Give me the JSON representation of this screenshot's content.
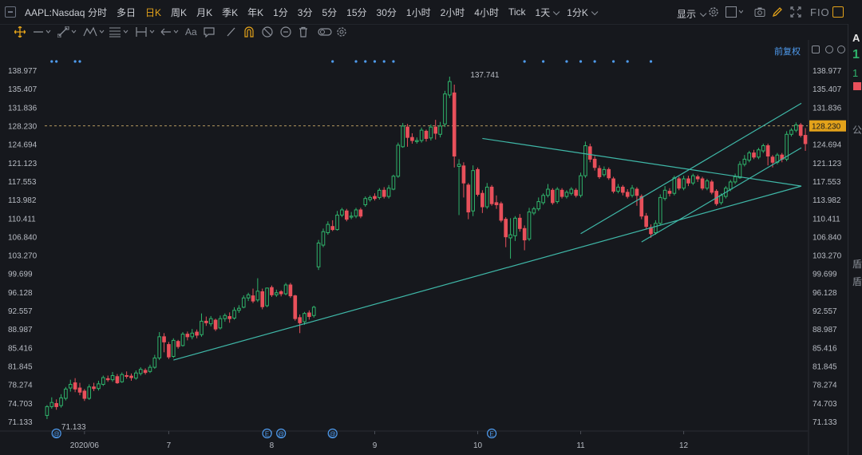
{
  "toolbar": {
    "symbol": "AAPL:Nasdaq",
    "periods": [
      {
        "label": "分时",
        "active": false
      },
      {
        "label": "多日",
        "active": false
      },
      {
        "label": "日K",
        "active": true
      },
      {
        "label": "周K",
        "active": false
      },
      {
        "label": "月K",
        "active": false
      },
      {
        "label": "季K",
        "active": false
      },
      {
        "label": "年K",
        "active": false
      },
      {
        "label": "1分",
        "active": false
      },
      {
        "label": "3分",
        "active": false
      },
      {
        "label": "5分",
        "active": false
      },
      {
        "label": "15分",
        "active": false
      },
      {
        "label": "30分",
        "active": false
      },
      {
        "label": "1小时",
        "active": false
      },
      {
        "label": "2小时",
        "active": false
      },
      {
        "label": "4小时",
        "active": false
      },
      {
        "label": "Tick",
        "active": false
      },
      {
        "label": "1天",
        "active": false
      },
      {
        "label": "1分K",
        "active": false
      }
    ],
    "display_label": "显示",
    "fio_label": "FIO",
    "text_tool_label": "Aa"
  },
  "adjust_label": "前复权",
  "side_panel": {
    "letters": [
      "A",
      "1",
      "1",
      "公",
      "盾",
      "盾"
    ]
  },
  "colors": {
    "up": "#2fb36b",
    "down": "#e8505b",
    "trend": "#3fb8a8",
    "accent": "#e3a21a",
    "link": "#4f9cf0"
  },
  "chart_data": {
    "type": "candlestick",
    "y_ticks": [
      "138.977",
      "135.407",
      "131.836",
      "128.230",
      "124.694",
      "121.123",
      "117.553",
      "113.982",
      "110.411",
      "106.840",
      "103.270",
      "99.699",
      "96.128",
      "92.557",
      "88.987",
      "85.416",
      "81.845",
      "78.274",
      "74.703",
      "71.133"
    ],
    "x_ticks": [
      "2020/06",
      "7",
      "8",
      "9",
      "10",
      "11",
      "12"
    ],
    "current_price": "128.230",
    "high_label": "137.741",
    "low_label": "71.133",
    "ylim": [
      71.133,
      138.977
    ],
    "event_markers": [
      "@",
      "E",
      "@",
      "@",
      "E"
    ],
    "candles": [
      [
        72.3,
        74.0,
        71.6,
        74.3
      ],
      [
        74.0,
        74.8,
        73.6,
        75.8
      ],
      [
        74.6,
        74.0,
        73.4,
        75.4
      ],
      [
        74.2,
        75.7,
        73.8,
        76.4
      ],
      [
        75.6,
        77.4,
        75.2,
        77.8
      ],
      [
        77.6,
        78.3,
        76.9,
        79.2
      ],
      [
        78.6,
        77.4,
        76.8,
        79.5
      ],
      [
        77.6,
        76.8,
        76.2,
        78.6
      ],
      [
        77.0,
        75.6,
        75.1,
        77.4
      ],
      [
        75.6,
        77.8,
        75.3,
        78.3
      ],
      [
        77.8,
        77.5,
        77.0,
        78.6
      ],
      [
        77.5,
        78.4,
        77.1,
        79.0
      ],
      [
        78.3,
        79.6,
        78.0,
        80.0
      ],
      [
        79.4,
        79.2,
        78.8,
        80.0
      ],
      [
        79.2,
        80.0,
        78.8,
        80.7
      ],
      [
        79.8,
        78.6,
        78.4,
        80.3
      ],
      [
        78.8,
        80.2,
        78.6,
        80.6
      ],
      [
        80.0,
        79.9,
        79.4,
        80.8
      ],
      [
        79.9,
        79.6,
        79.0,
        80.4
      ],
      [
        79.5,
        80.5,
        79.2,
        81.0
      ],
      [
        80.4,
        81.2,
        80.0,
        81.6
      ],
      [
        81.0,
        80.6,
        80.2,
        81.4
      ],
      [
        80.8,
        81.6,
        80.5,
        82.1
      ],
      [
        81.6,
        83.4,
        81.3,
        84.0
      ],
      [
        83.4,
        87.5,
        83.0,
        88.4
      ],
      [
        87.5,
        86.5,
        84.5,
        88.2
      ],
      [
        86.0,
        83.6,
        83.2,
        86.5
      ],
      [
        83.7,
        86.8,
        83.4,
        87.2
      ],
      [
        86.6,
        85.6,
        85.2,
        86.9
      ],
      [
        85.8,
        88.0,
        85.6,
        88.4
      ],
      [
        88.0,
        87.5,
        86.8,
        88.5
      ],
      [
        87.5,
        88.2,
        87.0,
        89.0
      ],
      [
        88.4,
        87.8,
        87.2,
        88.9
      ],
      [
        87.9,
        90.5,
        87.5,
        92.0
      ],
      [
        90.5,
        90.2,
        89.6,
        91.4
      ],
      [
        90.0,
        91.0,
        89.5,
        91.5
      ],
      [
        90.7,
        89.0,
        88.6,
        91.0
      ],
      [
        89.2,
        91.0,
        88.9,
        91.6
      ],
      [
        91.0,
        91.6,
        90.4,
        92.0
      ],
      [
        91.4,
        91.0,
        90.2,
        92.2
      ],
      [
        91.1,
        92.6,
        90.8,
        93.2
      ],
      [
        92.6,
        93.0,
        92.1,
        93.6
      ],
      [
        93.2,
        95.0,
        93.0,
        95.5
      ],
      [
        95.0,
        95.6,
        94.4,
        96.0
      ],
      [
        95.4,
        94.4,
        94.0,
        96.8
      ],
      [
        94.6,
        96.3,
        94.2,
        98.8
      ],
      [
        96.2,
        93.3,
        92.8,
        96.8
      ],
      [
        93.5,
        96.9,
        93.2,
        97.0
      ],
      [
        97.0,
        95.6,
        95.2,
        97.4
      ],
      [
        95.6,
        96.0,
        95.2,
        96.6
      ],
      [
        96.2,
        95.8,
        95.3,
        96.5
      ],
      [
        95.8,
        97.5,
        95.5,
        97.9
      ],
      [
        97.5,
        95.4,
        95.0,
        97.9
      ],
      [
        95.4,
        91.0,
        90.6,
        95.6
      ],
      [
        91.2,
        90.2,
        88.2,
        91.8
      ],
      [
        90.4,
        92.0,
        89.8,
        92.3
      ],
      [
        92.1,
        91.4,
        90.8,
        92.6
      ],
      [
        91.6,
        93.2,
        91.2,
        93.5
      ],
      [
        101.0,
        105.6,
        100.4,
        106.2
      ],
      [
        105.2,
        107.8,
        104.8,
        108.4
      ],
      [
        107.6,
        109.2,
        107.2,
        109.8
      ],
      [
        108.8,
        108.2,
        107.9,
        110.0
      ],
      [
        108.2,
        111.0,
        108.0,
        111.8
      ],
      [
        111.0,
        112.0,
        110.6,
        112.4
      ],
      [
        111.8,
        110.2,
        109.8,
        112.2
      ],
      [
        110.6,
        110.8,
        110.2,
        111.6
      ],
      [
        110.8,
        112.0,
        110.4,
        112.4
      ],
      [
        112.0,
        110.8,
        110.4,
        112.4
      ],
      [
        113.0,
        114.2,
        112.6,
        114.6
      ],
      [
        114.0,
        114.4,
        113.6,
        114.8
      ],
      [
        114.6,
        114.2,
        113.8,
        115.2
      ],
      [
        114.4,
        115.8,
        114.0,
        116.2
      ],
      [
        115.8,
        114.6,
        114.2,
        116.4
      ],
      [
        114.6,
        116.2,
        114.2,
        116.8
      ],
      [
        116.0,
        118.5,
        115.8,
        118.8
      ],
      [
        118.5,
        124.5,
        118.2,
        125.0
      ],
      [
        124.2,
        128.2,
        124.0,
        128.8
      ],
      [
        128.0,
        126.0,
        124.2,
        128.6
      ],
      [
        126.0,
        125.4,
        124.8,
        126.8
      ],
      [
        125.2,
        125.4,
        124.8,
        126.0
      ],
      [
        125.4,
        127.4,
        125.0,
        127.9
      ],
      [
        127.2,
        125.8,
        125.2,
        127.5
      ],
      [
        125.9,
        128.0,
        125.4,
        128.5
      ],
      [
        128.0,
        126.8,
        125.6,
        129.4
      ],
      [
        126.6,
        128.2,
        126.0,
        129.0
      ],
      [
        128.6,
        134.4,
        128.0,
        135.0
      ],
      [
        134.2,
        136.8,
        133.6,
        137.741
      ],
      [
        134.6,
        122.4,
        120.2,
        136.2
      ],
      [
        120.4,
        120.8,
        111.0,
        121.8
      ],
      [
        120.5,
        117.2,
        114.4,
        121.2
      ],
      [
        116.8,
        111.6,
        110.2,
        117.2
      ],
      [
        111.8,
        119.6,
        110.8,
        120.6
      ],
      [
        119.8,
        115.0,
        114.6,
        120.2
      ],
      [
        115.2,
        112.6,
        111.4,
        115.8
      ],
      [
        112.6,
        116.4,
        112.2,
        117.2
      ],
      [
        116.4,
        113.2,
        112.8,
        116.8
      ],
      [
        113.4,
        113.0,
        112.2,
        114.8
      ],
      [
        113.2,
        110.0,
        109.6,
        113.6
      ],
      [
        110.2,
        106.8,
        104.8,
        110.6
      ],
      [
        106.6,
        107.2,
        102.6,
        110.4
      ],
      [
        107.0,
        110.4,
        106.0,
        110.8
      ],
      [
        110.4,
        108.4,
        107.8,
        111.2
      ],
      [
        108.4,
        106.2,
        104.2,
        109.0
      ],
      [
        106.4,
        111.6,
        106.0,
        112.4
      ],
      [
        111.4,
        112.2,
        111.0,
        112.6
      ],
      [
        112.2,
        113.6,
        111.8,
        114.4
      ],
      [
        113.4,
        114.8,
        113.0,
        115.2
      ],
      [
        114.8,
        116.0,
        114.4,
        117.0
      ],
      [
        115.8,
        113.4,
        113.0,
        116.2
      ],
      [
        113.6,
        116.0,
        113.2,
        116.4
      ],
      [
        115.8,
        114.6,
        114.2,
        116.2
      ],
      [
        114.6,
        115.4,
        114.2,
        115.8
      ],
      [
        115.2,
        116.0,
        114.8,
        116.4
      ],
      [
        115.8,
        114.8,
        114.4,
        116.2
      ],
      [
        114.8,
        118.6,
        114.4,
        119.2
      ],
      [
        118.6,
        124.4,
        118.2,
        125.2
      ],
      [
        124.2,
        121.8,
        121.2,
        124.8
      ],
      [
        121.8,
        120.2,
        119.6,
        122.4
      ],
      [
        120.0,
        118.4,
        118.0,
        120.6
      ],
      [
        118.8,
        119.8,
        118.4,
        120.4
      ],
      [
        119.8,
        118.2,
        117.8,
        120.2
      ],
      [
        118.0,
        115.6,
        115.2,
        118.4
      ],
      [
        115.6,
        116.4,
        115.2,
        117.0
      ],
      [
        116.4,
        115.4,
        114.8,
        116.8
      ],
      [
        115.4,
        114.6,
        114.2,
        116.0
      ],
      [
        114.8,
        116.2,
        114.4,
        116.8
      ],
      [
        116.0,
        114.8,
        112.8,
        116.4
      ],
      [
        114.6,
        110.8,
        110.2,
        115.0
      ],
      [
        110.8,
        108.8,
        108.2,
        111.4
      ],
      [
        108.6,
        107.4,
        106.6,
        109.2
      ],
      [
        107.6,
        109.4,
        107.2,
        110.0
      ],
      [
        109.4,
        114.4,
        109.0,
        115.0
      ],
      [
        114.2,
        115.8,
        113.8,
        116.6
      ],
      [
        115.6,
        115.2,
        114.6,
        116.2
      ],
      [
        115.2,
        118.2,
        114.8,
        118.6
      ],
      [
        118.0,
        116.2,
        115.8,
        118.4
      ],
      [
        116.2,
        118.0,
        115.8,
        118.6
      ],
      [
        118.0,
        117.2,
        116.6,
        118.6
      ],
      [
        117.2,
        118.6,
        116.8,
        119.0
      ],
      [
        118.4,
        118.0,
        117.4,
        118.8
      ],
      [
        118.0,
        116.2,
        115.8,
        118.4
      ],
      [
        116.2,
        117.6,
        115.8,
        118.0
      ],
      [
        117.4,
        115.4,
        115.0,
        117.8
      ],
      [
        115.6,
        113.2,
        112.8,
        116.0
      ],
      [
        113.4,
        114.8,
        113.0,
        115.2
      ],
      [
        114.6,
        116.2,
        114.2,
        116.6
      ],
      [
        116.0,
        117.4,
        115.6,
        117.8
      ],
      [
        117.4,
        118.4,
        117.0,
        119.0
      ],
      [
        118.2,
        120.8,
        118.0,
        121.4
      ],
      [
        120.8,
        121.8,
        120.4,
        122.6
      ],
      [
        121.6,
        123.0,
        121.2,
        123.4
      ],
      [
        123.0,
        122.2,
        121.8,
        123.6
      ],
      [
        122.2,
        123.6,
        121.8,
        124.0
      ],
      [
        123.4,
        124.4,
        123.0,
        124.8
      ],
      [
        124.4,
        122.4,
        120.6,
        124.8
      ],
      [
        122.2,
        121.2,
        120.2,
        122.6
      ],
      [
        121.2,
        122.6,
        120.8,
        123.0
      ],
      [
        122.6,
        121.8,
        121.2,
        123.0
      ],
      [
        121.8,
        126.6,
        121.4,
        127.2
      ],
      [
        126.6,
        127.4,
        126.2,
        127.8
      ],
      [
        127.4,
        128.4,
        127.0,
        128.9
      ],
      [
        128.4,
        126.4,
        126.0,
        128.8
      ],
      [
        126.4,
        124.8,
        123.4,
        127.8
      ]
    ]
  }
}
